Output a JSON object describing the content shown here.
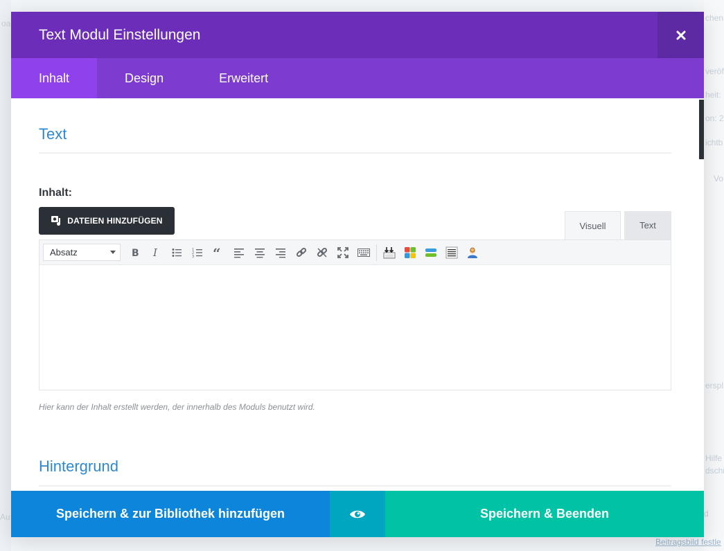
{
  "background": {
    "ghost_texts": [
      "oa",
      "chen",
      "veröffe",
      "heit: ",
      "on: 2",
      "ichtb",
      "Vo",
      "erspl",
      "Hilfe",
      "dschi",
      "Au",
      "d"
    ],
    "link": "Beitragsbild festle"
  },
  "modal": {
    "title": "Text Modul Einstellungen",
    "close_icon": "close-icon"
  },
  "tabs": [
    {
      "label": "Inhalt",
      "active": true
    },
    {
      "label": "Design",
      "active": false
    },
    {
      "label": "Erweitert",
      "active": false
    }
  ],
  "sections": {
    "text_title": "Text",
    "background_title": "Hintergrund"
  },
  "content_field": {
    "label": "Inhalt:",
    "add_media_label": "DATEIEN HINZUFÜGEN",
    "add_media_icon": "media-icon",
    "mode_visual": "Visuell",
    "mode_text": "Text",
    "format_value": "Absatz",
    "help": "Hier kann der Inhalt erstellt werden, der innerhalb des Moduls benutzt wird.",
    "toolbar_icons": [
      "bold-icon",
      "italic-icon",
      "bullet-list-icon",
      "numbered-list-icon",
      "blockquote-icon",
      "align-left-icon",
      "align-center-icon",
      "align-right-icon",
      "link-icon",
      "unlink-icon",
      "fullscreen-icon",
      "toolbar-toggle-icon",
      "insert-more-icon",
      "shortcodes-icon",
      "divider-icon",
      "paragraph-icon",
      "user-icon"
    ]
  },
  "footer": {
    "library_label": "Speichern & zur Bibliothek hinzufügen",
    "preview_icon": "eye-icon",
    "save_label": "Speichern & Beenden"
  },
  "colors": {
    "header": "#6c2eb9",
    "tabs": "#7e3bd0",
    "tab_active": "#8f42ec",
    "accent_blue": "#2e88d0",
    "btn_library": "#0c85da",
    "btn_preview": "#00a6bf",
    "btn_save": "#00c3a6"
  }
}
